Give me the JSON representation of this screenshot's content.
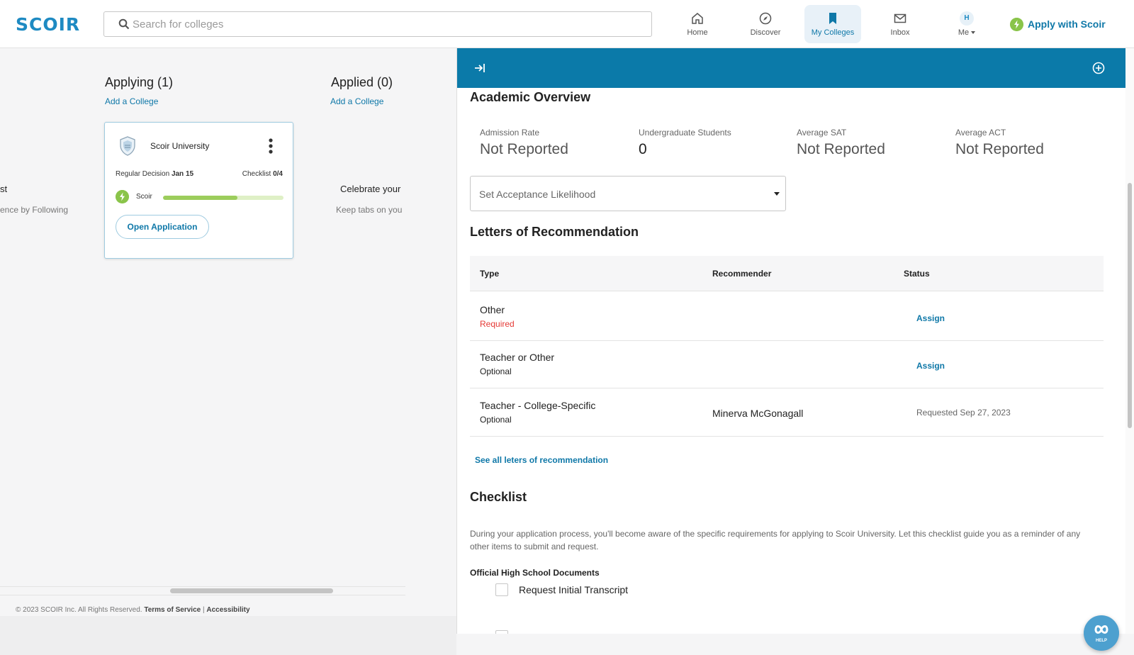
{
  "header": {
    "logo": "SCOIR",
    "search_placeholder": "Search for colleges",
    "nav": [
      {
        "label": "Home"
      },
      {
        "label": "Discover"
      },
      {
        "label": "My Colleges"
      },
      {
        "label": "Inbox"
      },
      {
        "label": "Me",
        "initial": "H"
      }
    ],
    "apply_label": "Apply with Scoir"
  },
  "board": {
    "applying": {
      "title": "Applying (1)",
      "add": "Add a College"
    },
    "applied": {
      "title": "Applied (0)",
      "add": "Add a College"
    },
    "card": {
      "college": "Scoir University",
      "deadline_label": "Regular Decision",
      "deadline_date": "Jan 15",
      "checklist_label": "Checklist",
      "checklist_count": "0/4",
      "platform": "Scoir",
      "progress": 0.62,
      "open_label": "Open Application"
    },
    "left_cut_title": "st",
    "left_cut_sub": "ence by Following",
    "right_cut_title": "Celebrate your",
    "right_cut_sub": "Keep tabs on you"
  },
  "footer": {
    "copyright": "© 2023 SCOIR Inc. All Rights Reserved.",
    "terms": "Terms of Service",
    "sep": "|",
    "accessibility": "Accessibility"
  },
  "panel": {
    "academic_title": "Academic Overview",
    "stats": [
      {
        "label": "Admission Rate",
        "value": "Not Reported"
      },
      {
        "label": "Undergraduate Students",
        "value": "0"
      },
      {
        "label": "Average SAT",
        "value": "Not Reported"
      },
      {
        "label": "Average ACT",
        "value": "Not Reported"
      }
    ],
    "likelihood_placeholder": "Set Acceptance Likelihood",
    "letters_title": "Letters of Recommendation",
    "columns": [
      "Type",
      "Recommender",
      "Status"
    ],
    "letters": [
      {
        "type": "Other",
        "requirement": "Required",
        "recommender": "",
        "status": "Assign"
      },
      {
        "type": "Teacher or Other",
        "requirement": "Optional",
        "recommender": "",
        "status": "Assign"
      },
      {
        "type": "Teacher - College-Specific",
        "requirement": "Optional",
        "recommender": "Minerva McGonagall",
        "status": "Requested Sep 27, 2023"
      }
    ],
    "see_all": "See all leters of recommendation",
    "checklist_title": "Checklist",
    "checklist_desc": "During your application process, you'll become aware of the specific requirements for applying to Scoir University. Let this checklist guide you as a reminder of any other items to submit and request.",
    "checklist_section": "Official High School Documents",
    "checklist_items": [
      "Request Initial Transcript"
    ]
  },
  "help_label": "HELP",
  "colors": {
    "primary": "#0b7aa9",
    "link": "#0f78a8",
    "accent_green": "#8ac44a",
    "required_red": "#e53935"
  }
}
